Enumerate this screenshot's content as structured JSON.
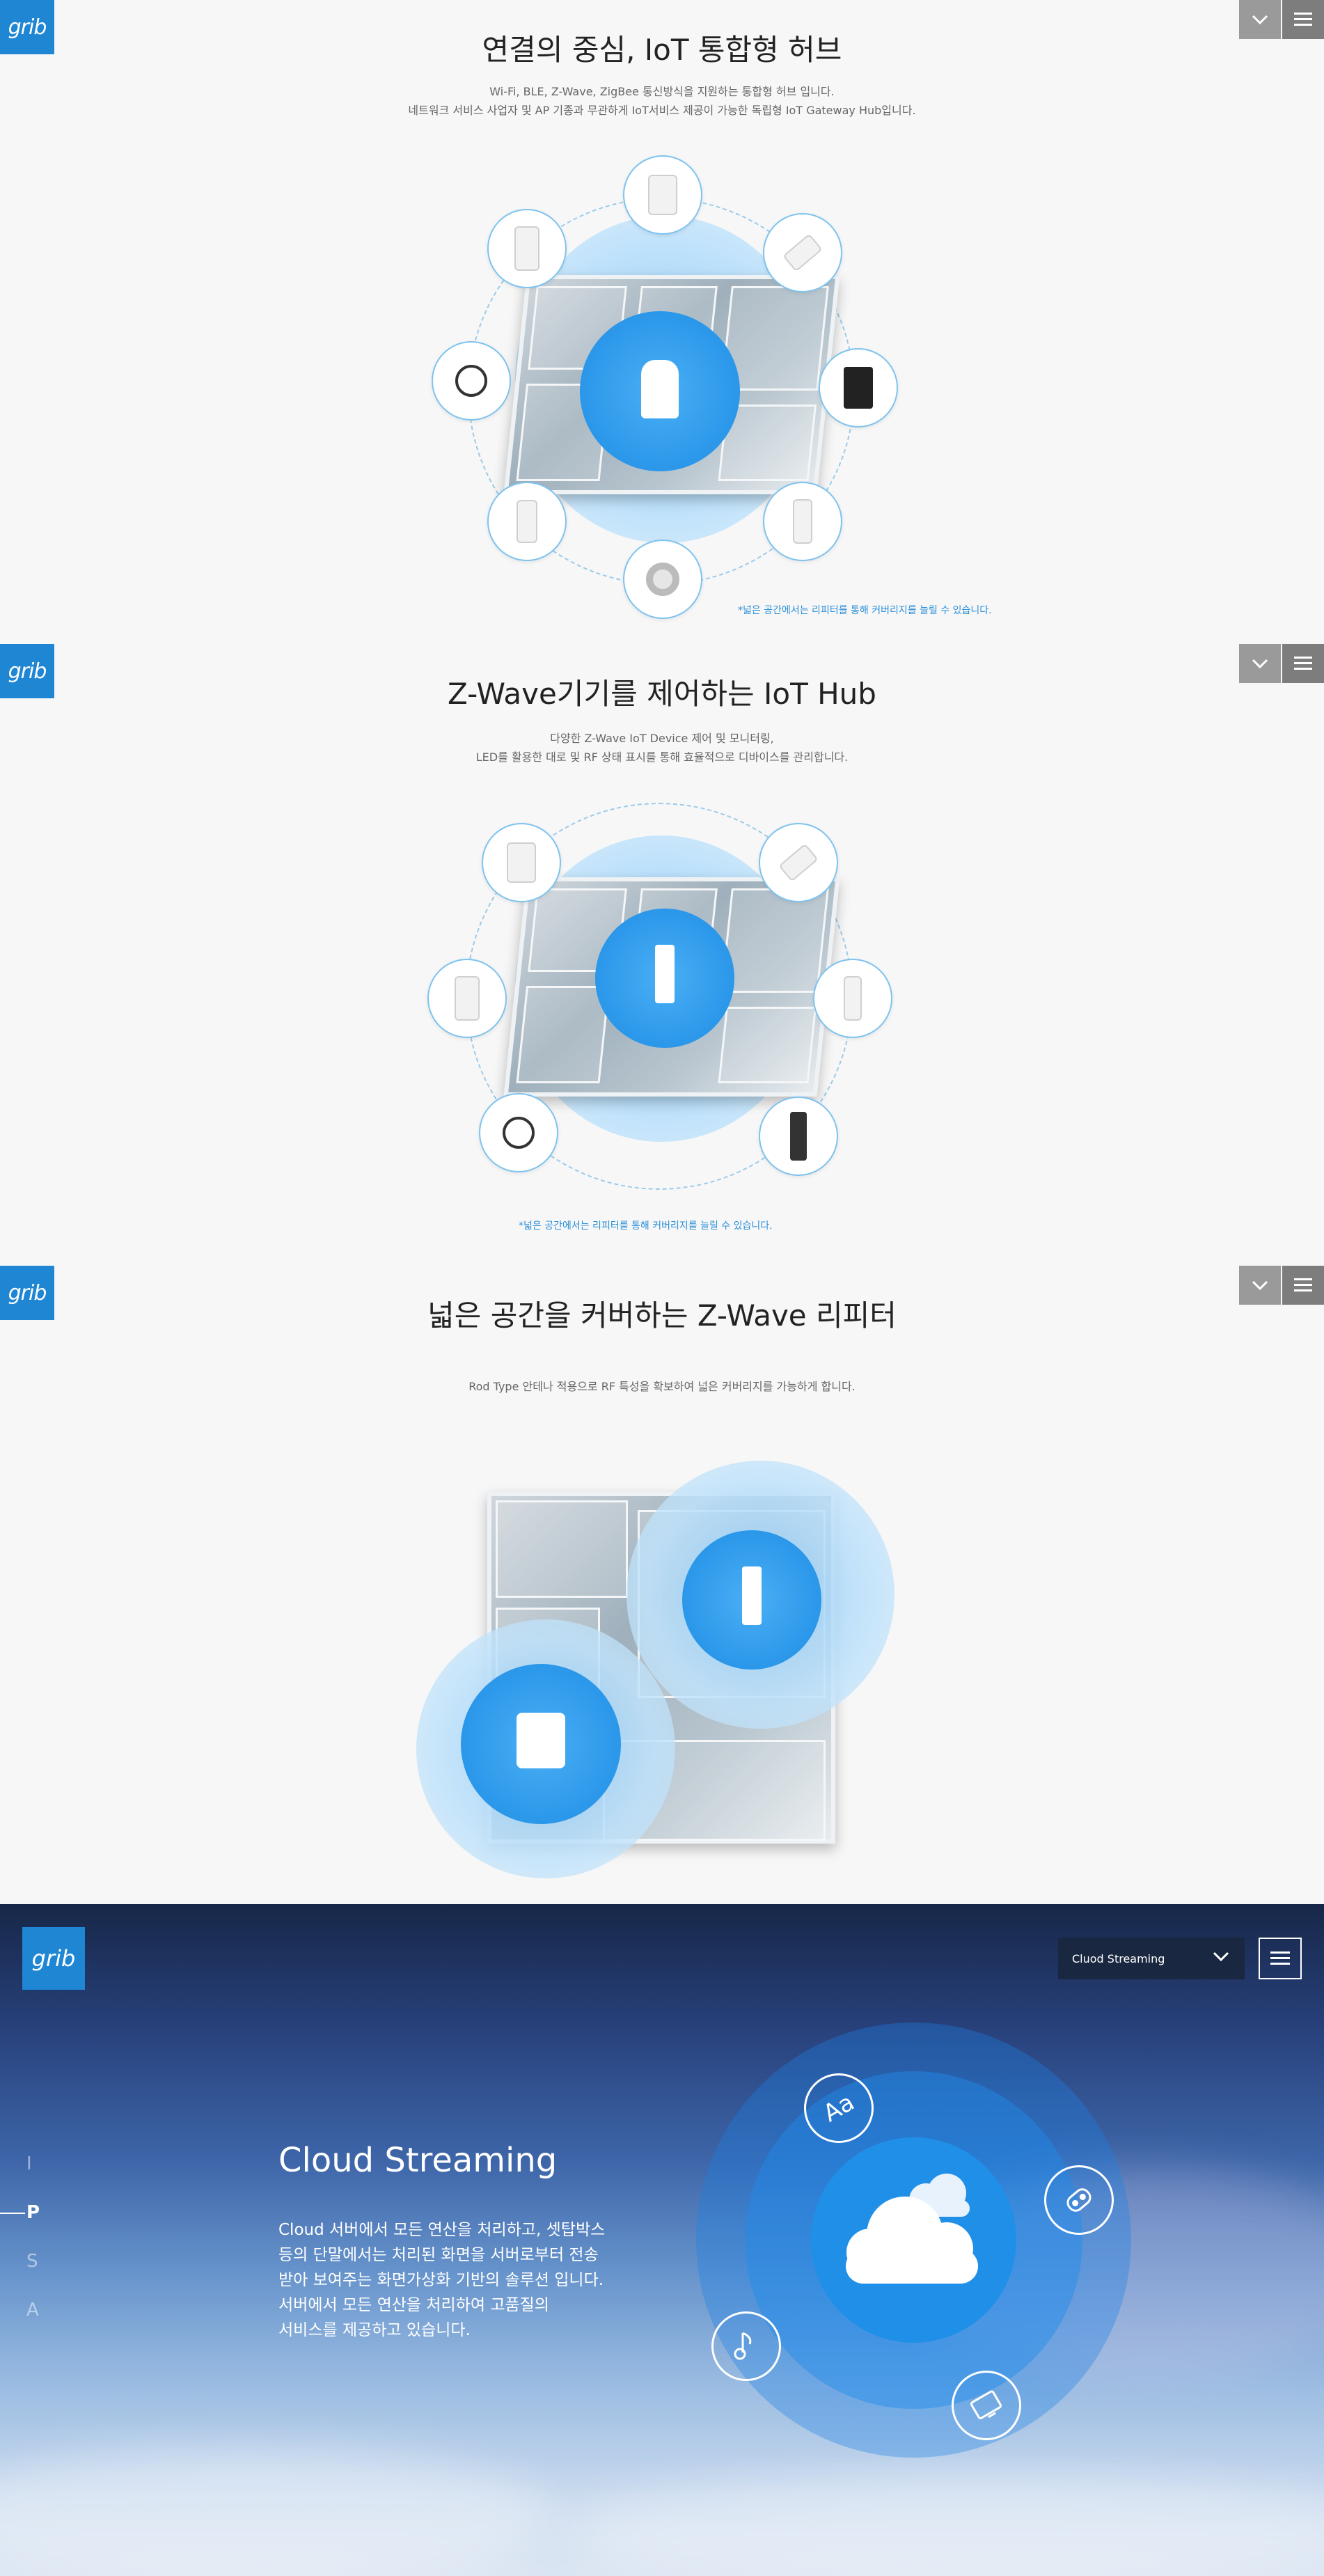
{
  "brand": {
    "logo_text": "grib"
  },
  "sections": [
    {
      "title": "연결의 중심, IoT 통합형 허브",
      "desc_lines": [
        "Wi-Fi, BLE, Z-Wave, ZigBee 통신방식을 지원하는 통합형 허브 입니다.",
        "네트워크 서비스 사업자 및 AP 기종과 무관하게 IoT서비스 제공이 가능한 독립형 IoT Gateway Hub입니다."
      ],
      "note": "*넓은 공간에서는 리피터를 통해 커버리지를 늘릴 수 있습니다."
    },
    {
      "title": "Z-Wave기기를 제어하는 IoT Hub",
      "desc_lines": [
        "다양한 Z-Wave IoT Device 제어 및 모니터링,",
        "LED를 활용한 대로 및 RF 상태 표시를 통해 효율적으로 디바이스를 관리합니다."
      ],
      "note": "*넓은 공간에서는 리피터를 통해 커버리지를 늘릴 수 있습니다."
    },
    {
      "title": "넓은 공간을 커버하는 Z-Wave 리피터",
      "desc_lines": [
        "Rod Type 안테나 적용으로 RF 특성을 확보하여 넓은 커버리지를 가능하게 합니다."
      ]
    }
  ],
  "cloud": {
    "select_value": "Cluod Streaming",
    "title": "Cloud Streaming",
    "desc_lines": [
      "Cloud 서버에서 모든 연산을 처리하고, 셋탑박스",
      "등의 단말에서는 처리된 화면을 서버로부터 전송",
      "받아 보여주는 화면가상화 기반의 솔루션 입니다.",
      "서버에서 모든 연산을 처리하여 고품질의",
      "서비스를 제공하고 있습니다."
    ],
    "side_nav": [
      "I",
      "P",
      "S",
      "A"
    ],
    "active_nav": "P"
  },
  "icons": {
    "dropdown": "chevron-down-icon",
    "menu": "hamburger-menu-icon",
    "cloud": "cloud-icon",
    "font": "font-aa-icon",
    "game": "gamepad-icon",
    "music": "music-note-icon",
    "tv": "tv-icon"
  },
  "colors": {
    "brand": "#1f86d4",
    "accent_blue": "#2b97ea",
    "note_blue": "#2a8fd8"
  }
}
